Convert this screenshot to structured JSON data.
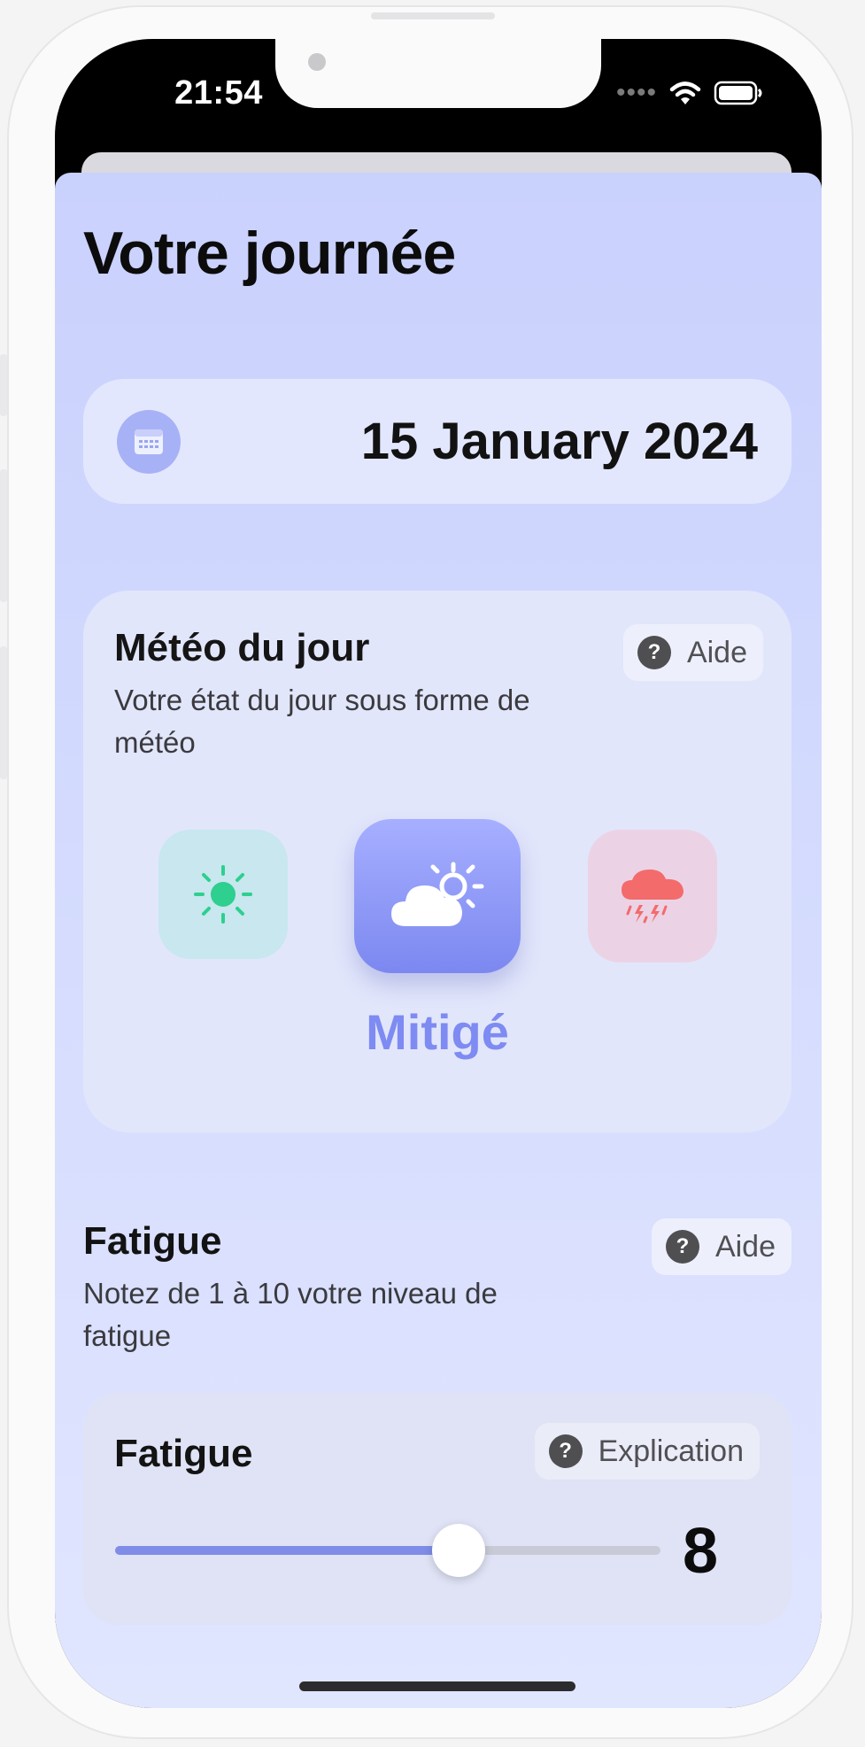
{
  "status_bar": {
    "time": "21:54",
    "signal_dots": "••••"
  },
  "page": {
    "title": "Votre journée"
  },
  "date_picker": {
    "date": "15 January 2024"
  },
  "weather": {
    "title": "Météo du jour",
    "subtitle": "Votre état du jour sous forme de météo",
    "help_label": "Aide",
    "help_icon": "?",
    "options": [
      "sun-icon",
      "cloud-sun-icon",
      "cloud-storm-icon"
    ],
    "selected_label": "Mitigé"
  },
  "fatigue": {
    "title": "Fatigue",
    "subtitle": "Notez de 1 à 10 votre niveau de fatigue",
    "help_label": "Aide",
    "help_icon": "?",
    "slider": {
      "label": "Fatigue",
      "explanation_label": "Explication",
      "value": 8,
      "value_text": "8",
      "min": 1,
      "max": 10
    }
  },
  "colors": {
    "accent": "#7e8bf2",
    "sunny_green": "#2ecf8f",
    "storm_red": "#f36b6b",
    "background": "#cdd5fe"
  }
}
